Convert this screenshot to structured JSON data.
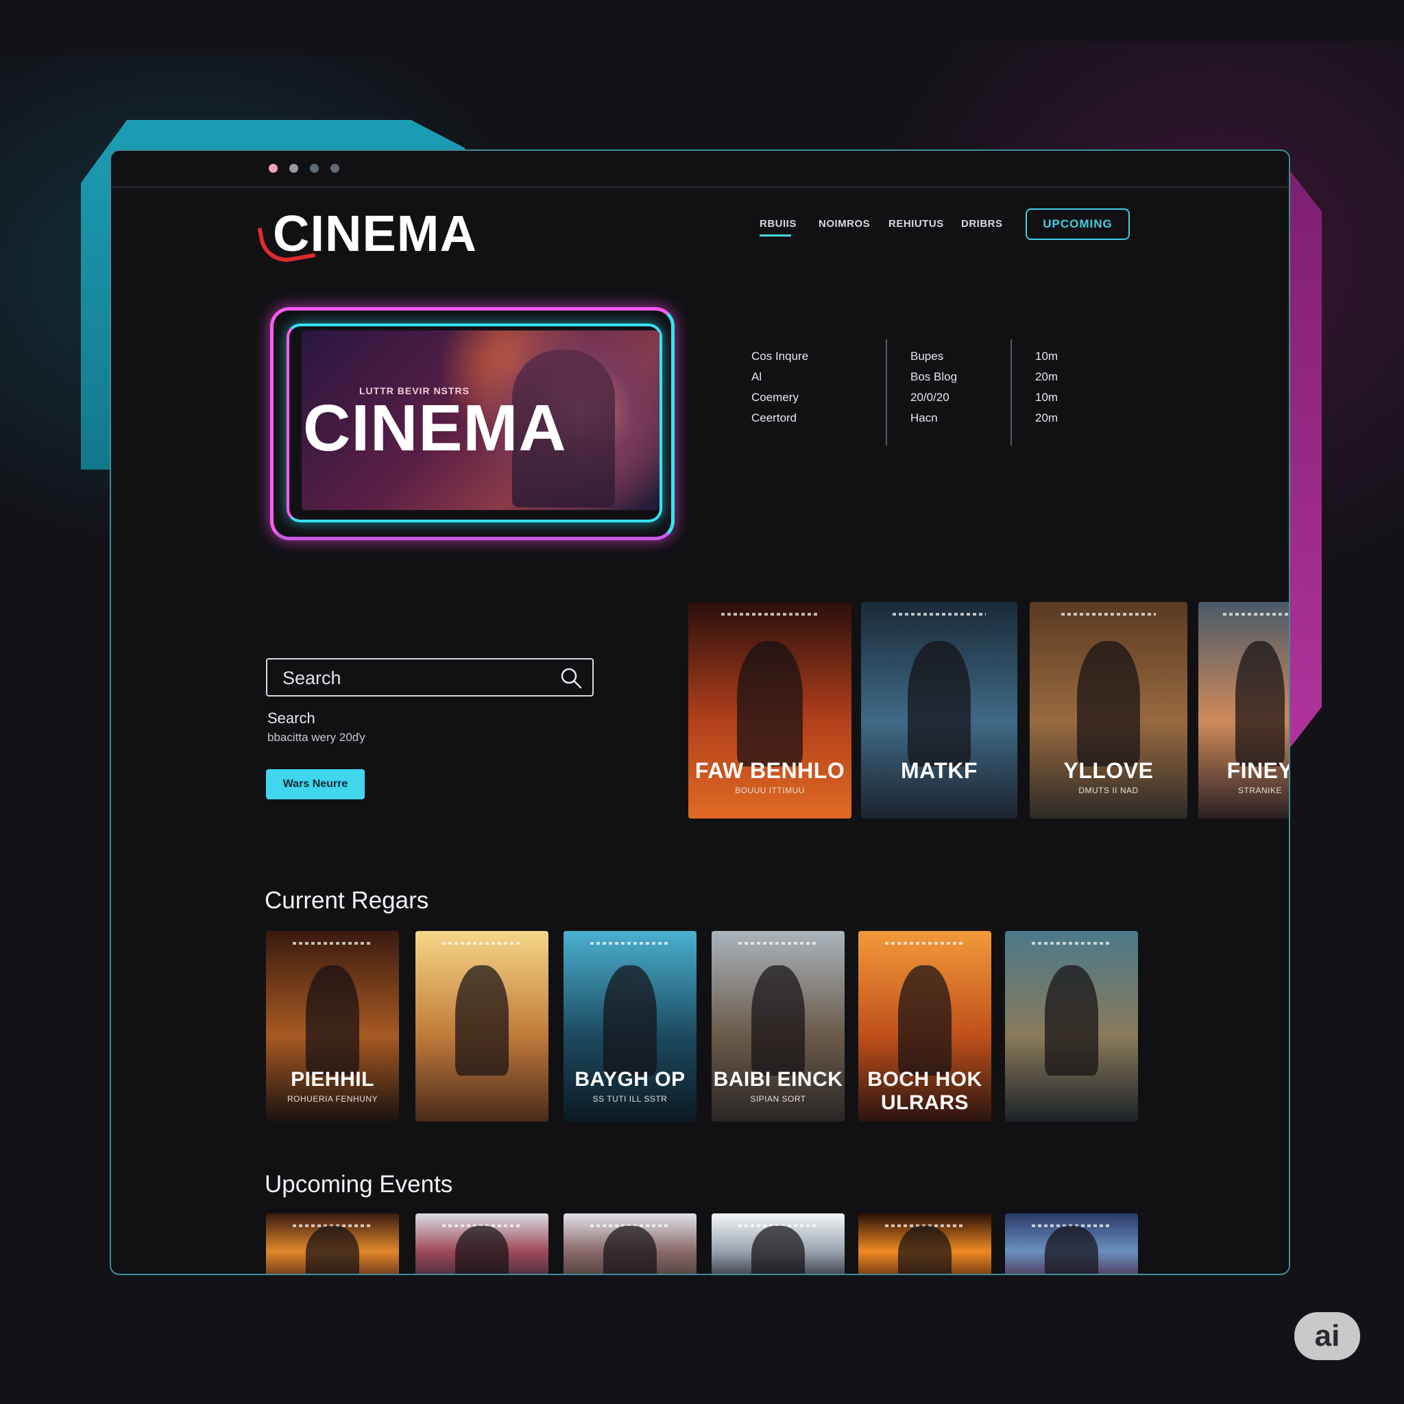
{
  "window": {
    "dots": [
      "#f2a0b8",
      "#9a9aa2",
      "#5e6a7a",
      "#5e6a7a"
    ]
  },
  "header": {
    "logo": "CINEMA",
    "nav": [
      "RBUIIS",
      "NOIMROS",
      "REHIUTUS",
      "DRIBRS"
    ],
    "upcoming_button": "UPCOMING"
  },
  "hero": {
    "tagline": "LUTTR BEVIR NSTRS",
    "title": "CINEMA"
  },
  "info": {
    "col1": [
      "Cos Inqure",
      "Al",
      "Coemery",
      "Ceertord"
    ],
    "col2": [
      "Bupes",
      "Bos Blog",
      "20/0/20",
      "Hacn"
    ],
    "col3": [
      "10m",
      "20m",
      "10m",
      "20m"
    ]
  },
  "search": {
    "placeholder": "Search",
    "label": "Search",
    "subtext": "bbacitta wery 20ďy",
    "button": "Wars Neurre"
  },
  "featured": [
    {
      "title": "FAW BENHLO",
      "subtitle": "BOUUU ITTIMUU",
      "colors": [
        "#2a0f0c",
        "#b3401c",
        "#e06a22"
      ]
    },
    {
      "title": "MATKF",
      "subtitle": "",
      "colors": [
        "#1a2a38",
        "#3f6a86",
        "#1c2430"
      ]
    },
    {
      "title": "YLLOVE",
      "subtitle": "DMUTS II NAD",
      "colors": [
        "#5a3a22",
        "#9a6a40",
        "#2c2a26"
      ]
    },
    {
      "title": "FINEY",
      "subtitle": "STRANIKE",
      "colors": [
        "#4a5a6a",
        "#d08a5a",
        "#2a2024"
      ]
    }
  ],
  "current_section": {
    "title": "Current Regars",
    "posters": [
      {
        "title": "PIEHHIL",
        "subtitle": "ROHUERIA FENHUNY",
        "colors": [
          "#3a1a10",
          "#a85a22",
          "#1a1210"
        ]
      },
      {
        "title": "",
        "subtitle": "",
        "colors": [
          "#f6d68a",
          "#c07a3a",
          "#4a2a1a"
        ]
      },
      {
        "title": "BAYGH OP",
        "subtitle": "SS TUTI ILL SSTR",
        "colors": [
          "#4ab0d0",
          "#1c4a60",
          "#0c1a24"
        ]
      },
      {
        "title": "BAIBI EINCK",
        "subtitle": "SIPIAN SORT",
        "colors": [
          "#aab4bc",
          "#6a5a4a",
          "#2a2626"
        ]
      },
      {
        "title": "BOCH HOK ULRARS",
        "subtitle": "",
        "colors": [
          "#f29a3a",
          "#c0501a",
          "#2a1410"
        ]
      },
      {
        "title": "",
        "subtitle": "",
        "colors": [
          "#4a7a8a",
          "#8a7a5a",
          "#1c2228"
        ]
      }
    ]
  },
  "upcoming_section": {
    "title": "Upcoming Events",
    "posters": [
      {
        "colors": [
          "#3a1a10",
          "#e0882a",
          "#5a2a1a"
        ]
      },
      {
        "colors": [
          "#d8dce2",
          "#a04a5a",
          "#3a2a3a"
        ]
      },
      {
        "colors": [
          "#e0e2e8",
          "#8a6a6a",
          "#4a3a3a"
        ]
      },
      {
        "colors": [
          "#f4f6f8",
          "#9aa4b0",
          "#2a2a32"
        ]
      },
      {
        "colors": [
          "#2a1008",
          "#f08a22",
          "#5a2a10"
        ]
      },
      {
        "colors": [
          "#2a3a6a",
          "#6a90c0",
          "#4a2a4a"
        ]
      }
    ]
  },
  "badge": "ai"
}
